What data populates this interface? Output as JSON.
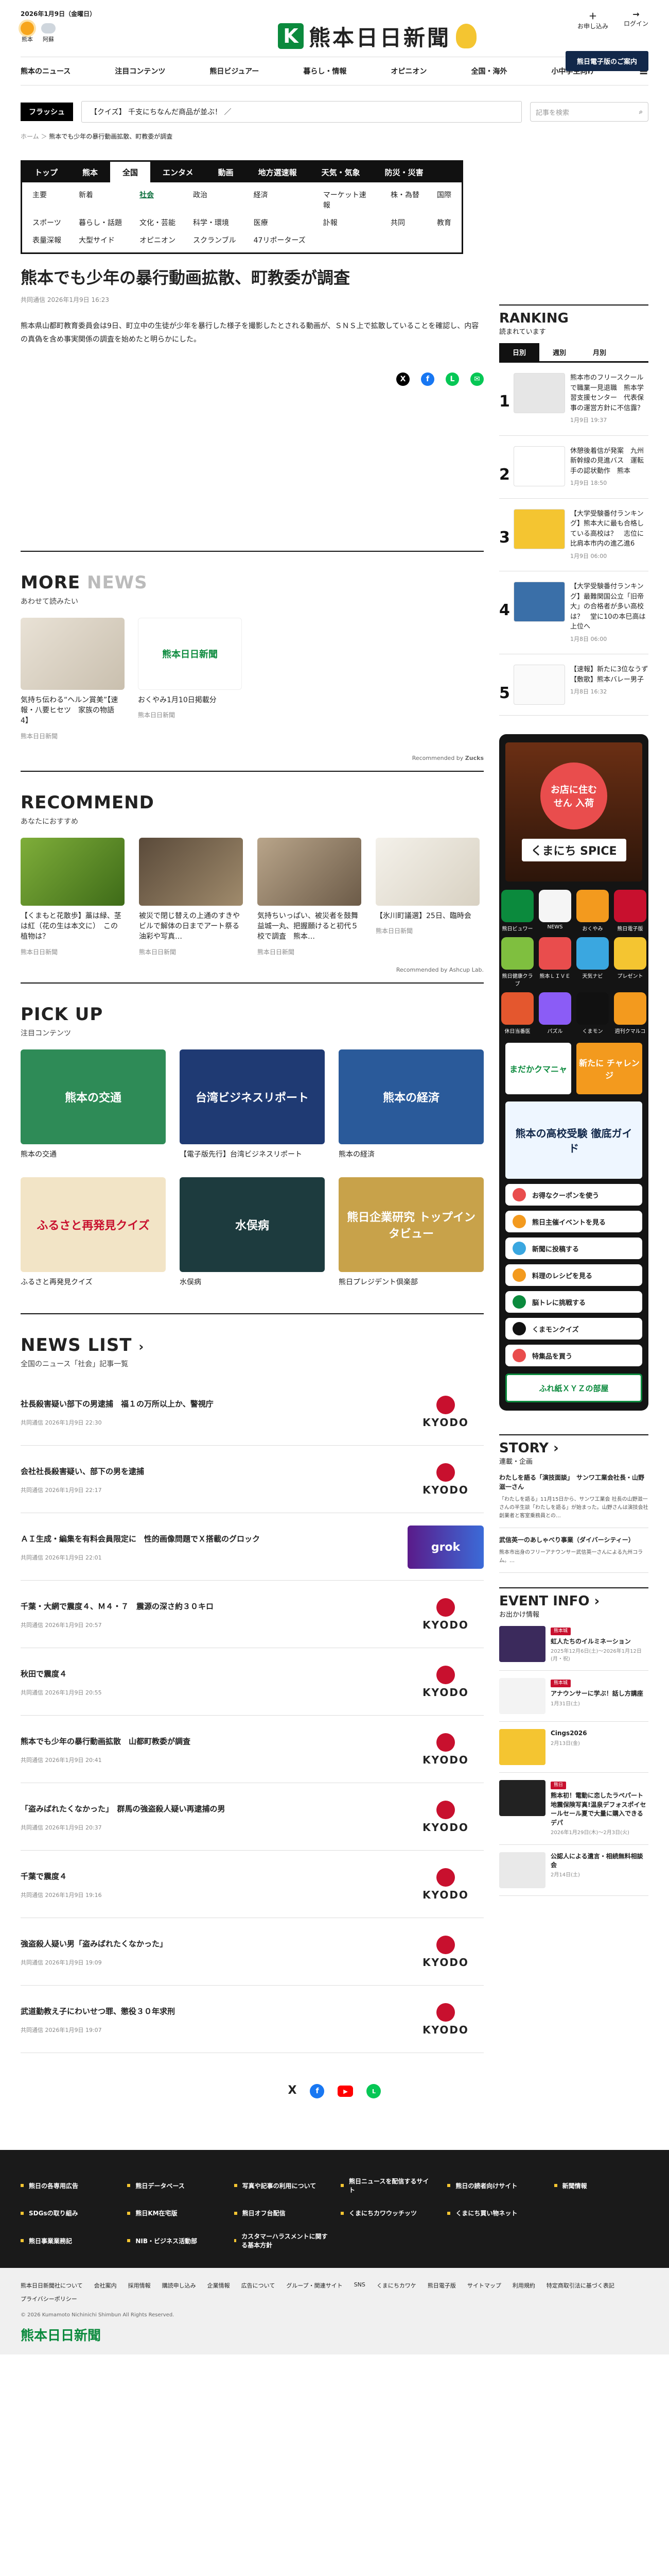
{
  "header": {
    "date": "2026年1月9日（金曜日）",
    "weather": [
      {
        "place": "熊本",
        "kind": "sun-icon"
      },
      {
        "place": "阿蘇",
        "kind": "cloud-icon"
      }
    ],
    "logo_mark": "K",
    "logo_text": "熊本日日新聞",
    "links": [
      {
        "label": "お申し込み",
        "icon": "user-add-icon"
      },
      {
        "label": "ログイン",
        "icon": "login-icon"
      }
    ],
    "digital_button": "熊日電子版のご案内"
  },
  "gnav": [
    "熊本のニュース",
    "注目コンテンツ",
    "熊日ビジュアー",
    "暮らし・情報",
    "オピニオン",
    "全国・海外",
    "小中学生向け"
  ],
  "flash": {
    "label": "フラッシュ",
    "text": "【クイズ】 千支にちなんだ商品が並ぶ！ ／",
    "search_placeholder": "記事を検索"
  },
  "breadcrumb": {
    "home": "ホーム",
    "current": "熊本でも少年の暴行動画拡散、町教委が調査"
  },
  "catnav": {
    "top": [
      "トップ",
      "熊本",
      "全国",
      "エンタメ",
      "動画",
      "地方選速報",
      "天気・気象",
      "防災・災害"
    ],
    "top_active": 2,
    "sub": [
      "主要",
      "新着",
      "社会",
      "政治",
      "経済",
      "マーケット速報",
      "株・為替",
      "国際",
      "スポーツ",
      "暮らし・話題",
      "文化・芸能",
      "科学・環境",
      "医療",
      "訃報",
      "共同",
      "教育",
      "表量深報",
      "大型サイド",
      "オピニオン",
      "スクランブル",
      "47リポーターズ"
    ],
    "sub_active": 2
  },
  "article": {
    "title": "熊本でも少年の暴行動画拡散、町教委が調査",
    "date": "共同通信 2026年1月9日 16:23",
    "lead": "熊本県山都町教育委員会は9日、町立中の生徒が少年を暴行した様子を撮影したとされる動画が、ＳＮＳ上で拡散していることを確認し、内容の真偽を含め事実関係の調査を始めたと明らかにした。",
    "share": [
      "x-icon",
      "facebook-icon",
      "line-icon",
      "mail-icon"
    ]
  },
  "more_news": {
    "heading": "MORE",
    "heading_gray": "NEWS",
    "sub": "あわせて読みたい",
    "items": [
      {
        "title": "気持ち伝わる“ヘルン賞美”【速報・八要ヒセツ　家族の物語 4】",
        "meta": "熊本日日新聞"
      },
      {
        "title": "おくやみ1月10日掲載分",
        "meta": "熊本日日新聞"
      }
    ],
    "powered": "Recommended by",
    "powered_brand": "Zucks"
  },
  "recommend": {
    "heading": "RECOMMEND",
    "sub": "あなたにおすすめ",
    "items": [
      {
        "title": "【くまもと花散歩】藁は緑、茎は紅（花の生は本文に）　この植物は？",
        "meta": "熊本日日新聞"
      },
      {
        "title": "被災で閉じ替えの上通のすきやビルで解体の日までアート祭る　油彩や写真…",
        "meta": "熊本日日新聞"
      },
      {
        "title": "気持ちいっぱい、被災者を鼓舞　益城一丸、把握願けると初代５校で調査　熊本…",
        "meta": "熊本日日新聞"
      },
      {
        "title": "【氷川町議選】25日、臨時会",
        "meta": "熊本日日新聞"
      }
    ],
    "powered": "Recommended by Ashcup Lab."
  },
  "pickup": {
    "heading": "PICK UP",
    "sub": "注目コンテンツ",
    "items": [
      {
        "title": "熊本の交通",
        "img_text": "熊本の交通"
      },
      {
        "title": "【電子版先行】台湾ビジネスリポート",
        "img_text": "台湾ビジネスリポート"
      },
      {
        "title": "熊本の経済",
        "img_text": "熊本の経済"
      },
      {
        "title": "ふるさと再発見クイズ",
        "img_text": "ふるさと再発見クイズ"
      },
      {
        "title": "水俣病",
        "img_text": "水俣病"
      },
      {
        "title": "熊日プレジデント倶楽部",
        "img_text": "熊日企業研究 トップインタビュー"
      }
    ]
  },
  "news_list": {
    "heading": "NEWS LIST",
    "sub": "全国のニュース「社会」記事一覧",
    "items": [
      {
        "title": "社長殺害疑い部下の男逮捕　福１の万所以上か、警視庁",
        "date": "共同通信 2026年1月9日 22:30"
      },
      {
        "title": "会社社長殺害疑い、部下の男を逮捕",
        "date": "共同通信 2026年1月9日 22:17"
      },
      {
        "title": "ＡＩ生成・編集を有料会員限定に　性的画像問題でＸ搭載のグロック",
        "date": "共同通信 2026年1月9日 22:01",
        "logo": "grok"
      },
      {
        "title": "千葉・大網で震度４、Ｍ４・７　震源の深さ約３０キロ",
        "date": "共同通信 2026年1月9日 20:57"
      },
      {
        "title": "秋田で震度４",
        "date": "共同通信 2026年1月9日 20:55"
      },
      {
        "title": "熊本でも少年の暴行動画拡散　山都町教委が調査",
        "date": "共同通信 2026年1月9日 20:41"
      },
      {
        "title": "「盗みばれたくなかった」　群馬の強盗殺人疑い再逮捕の男",
        "date": "共同通信 2026年1月9日 20:37"
      },
      {
        "title": "千葉で震度４",
        "date": "共同通信 2026年1月9日 19:16"
      },
      {
        "title": "強盗殺人疑い男「盗みばれたくなかった」",
        "date": "共同通信 2026年1月9日 19:09"
      },
      {
        "title": "武道勤教え子にわいせつ罪、懲役３０年求刑",
        "date": "共同通信 2026年1月9日 19:07"
      }
    ],
    "source": "KYODO"
  },
  "ranking": {
    "heading": "RANKING",
    "sub": "読まれています",
    "tabs": [
      "日別",
      "週別",
      "月別"
    ],
    "items": [
      {
        "no": "1",
        "title": "熊本市のフリースクールで職業一見退職　熊本学習支援センター　代表保事の運営方針に不信露？",
        "time": "1月9日 19:37"
      },
      {
        "no": "2",
        "title": "休憩後着信が発案　九州新幹線の見進バス　運転手の認状動作　熊本",
        "time": "1月9日 18:50"
      },
      {
        "no": "3",
        "title": "【大学受験番付ランキング】熊本大に最も合格している高校は？　志位に比肩本市内の進乙進6",
        "time": "1月9日 06:00"
      },
      {
        "no": "4",
        "title": "【大学受験番付ランキング】最難関国公立「旧帝大」の合格者が多い高校は？　堂に10の本巳高は上位へ",
        "time": "1月8日 06:00"
      },
      {
        "no": "5",
        "title": "【速報】新たに3位なうず【敷歌】熊本バレー男子",
        "time": "1月8日 16:32"
      }
    ]
  },
  "side_promos": {
    "shop_banner": "くまにち SPICE",
    "shop_tagline": "お店に住むせん 入荷",
    "tiles": [
      {
        "label": "熊日ビュワー"
      },
      {
        "label": "NEWS"
      },
      {
        "label": "おくやみ"
      },
      {
        "label": "熊日電子版"
      },
      {
        "label": "熊日健康クラブ"
      },
      {
        "label": "熊本ＬＩＶＥ"
      },
      {
        "label": "天気ナビ"
      },
      {
        "label": "プレゼント"
      },
      {
        "label": "休日当番医"
      },
      {
        "label": "パズル"
      },
      {
        "label": "くまモン"
      },
      {
        "label": "週刊クマルコ"
      }
    ],
    "kids": "まだかクマニャ",
    "challenge": "新たに チャレンジ",
    "school": "熊本の高校受験 徹底ガイド",
    "pills": [
      "お得なクーポンを使う",
      "熊日主催イベントを見る",
      "新聞に投稿する",
      "料理のレシピを見る",
      "脳トレに挑戦する",
      "くまモンクイズ",
      "特集品を買う"
    ],
    "bottom_banner": "ふれ紙ＸＹＺの部屋"
  },
  "story": {
    "heading": "STORY",
    "sub": "連載・企画",
    "items": [
      {
        "title": "わたしを語る「演技面談」　サンワ工業会社長・山野滋一さん",
        "desc": "「わたしを語る」11月15日から、サンワ工業会 社長の山野滋一さんの半生談「わたしを語る」が始まった。山野さんは演技会社創業者と客室乗務員との…"
      },
      {
        "title": "武信英一のあしゃべり事業（ダイバーシティー）",
        "desc": "熊本市出身のフリーアナウンサー武信英一さんによる九州コラム。…"
      }
    ]
  },
  "event": {
    "heading": "EVENT INFO",
    "sub": "お出かけ情報",
    "items": [
      {
        "tag": "熊本城",
        "title": "虹人たちのイルミネーション",
        "date": "2025年12月6日(土)〜2026年1月12日(月・祝)"
      },
      {
        "tag": "熊本城",
        "title": "アナウンサーに学ぶ！話し方講座",
        "date": "1月31日(土)"
      },
      {
        "tag": "",
        "title": "Cings2026",
        "date": "2月13日(金)"
      },
      {
        "tag": "熊日",
        "title": "熊本初！電動に恋したラペパート地震保険写真!温泉デフォスポイセールセール夏で大量に購入できるデパ",
        "date": "2026年1月29日(木)〜2月3日(火)"
      },
      {
        "tag": "",
        "title": "公認人による遺言・相続無料相談会",
        "date": "2月14日(土)"
      }
    ]
  },
  "footer": {
    "social": [
      "x-icon",
      "facebook-icon",
      "youtube-icon",
      "line-icon"
    ],
    "links": [
      "熊日の各専用広告",
      "熊日データベース",
      "写真や記事の利用について",
      "熊日ニュースを配信するサイト",
      "熊日の読者向けサイト",
      "新聞情報",
      "SDGsの取り組み",
      "熊日KM在宅版",
      "熊日オフ台配信",
      "くまにちカワウッチッツ",
      "くまにち買い物ネット",
      "",
      "熊日事業業務記",
      "NIB・ビジネス活動部",
      "カスタマーハラスメントに関する基本方針"
    ],
    "light_links": [
      "熊本日日新聞社について",
      "会社案内",
      "採用情報",
      "購読申し込み",
      "企業情報",
      "広告について",
      "グループ・関連サイト",
      "SNS",
      "くまにちカワケ",
      "熊日電子版",
      "サイトマップ",
      "利用規約",
      "特定商取引法に基づく表記",
      "プライバシーポリシー"
    ],
    "copyright": "© 2026 Kumamoto Nichinichi Shimbun All Rights Reserved.",
    "logo_text": "熊本日日新聞"
  },
  "colors": {
    "brand": "#0b8a3d",
    "navy": "#12284a",
    "kyodo_red": "#c8102e",
    "dark": "#141414",
    "accent_yellow": "#f4c531"
  }
}
